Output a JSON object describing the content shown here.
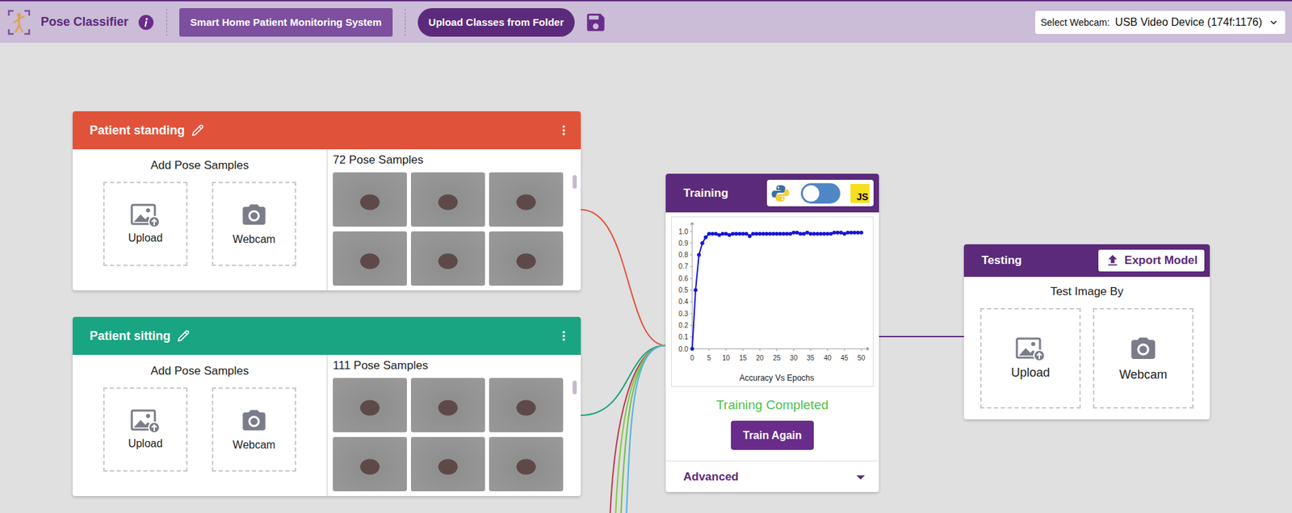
{
  "app": {
    "title": "Pose Classifier",
    "project_button": "Smart Home Patient Monitoring System",
    "upload_button": "Upload Classes from Folder",
    "webcam_label": "Select Webcam:",
    "webcam_value": "USB Video Device (174f:1176)"
  },
  "classes": [
    {
      "name": "Patient standing",
      "color": "#e0533a",
      "add_label": "Add Pose Samples",
      "upload": "Upload",
      "webcam": "Webcam",
      "count": "72 Pose Samples",
      "visible_samples": 6
    },
    {
      "name": "Patient sitting",
      "color": "#1aa582",
      "add_label": "Add Pose Samples",
      "upload": "Upload",
      "webcam": "Webcam",
      "count": "111 Pose Samples",
      "visible_samples": 6
    }
  ],
  "connections": [
    {
      "kind": "class",
      "color": "#e0533a"
    },
    {
      "kind": "class",
      "color": "#1aa582"
    },
    {
      "kind": "offscreen",
      "color": "#b73b4f"
    },
    {
      "kind": "offscreen",
      "color": "#8bc34a"
    },
    {
      "kind": "offscreen",
      "color": "#6cc24a"
    },
    {
      "kind": "offscreen",
      "color": "#4fb3e0"
    },
    {
      "kind": "output",
      "color": "#5c2a7a"
    }
  ],
  "training": {
    "title": "Training",
    "js_label": "JS",
    "js_selected": false,
    "chart": {
      "y_ticks": [
        "0.0",
        "0.1",
        "0.2",
        "0.3",
        "0.4",
        "0.5",
        "0.6",
        "0.7",
        "0.8",
        "0.9",
        "1.0"
      ],
      "x_ticks": [
        "0",
        "5",
        "10",
        "15",
        "20",
        "25",
        "30",
        "35",
        "40",
        "45",
        "50"
      ],
      "x_label": "Accuracy Vs Epochs",
      "values": [
        0,
        0.5,
        0.8,
        0.9,
        0.95,
        0.98,
        0.98,
        0.98,
        0.97,
        0.98,
        0.98,
        0.97,
        0.98,
        0.98,
        0.98,
        0.98,
        0.98,
        0.96,
        0.98,
        0.98,
        0.98,
        0.98,
        0.98,
        0.98,
        0.98,
        0.98,
        0.98,
        0.98,
        0.98,
        0.98,
        0.99,
        0.99,
        0.98,
        0.98,
        0.99,
        0.98,
        0.98,
        0.98,
        0.98,
        0.98,
        0.98,
        0.98,
        0.99,
        0.99,
        0.99,
        0.98,
        0.99,
        0.99,
        0.99,
        0.99,
        0.99
      ]
    },
    "status": "Training Completed",
    "button": "Train Again",
    "advanced": "Advanced",
    "advanced_expanded": false
  },
  "testing": {
    "title": "Testing",
    "export": "Export Model",
    "prompt": "Test Image By",
    "upload": "Upload",
    "webcam": "Webcam"
  }
}
